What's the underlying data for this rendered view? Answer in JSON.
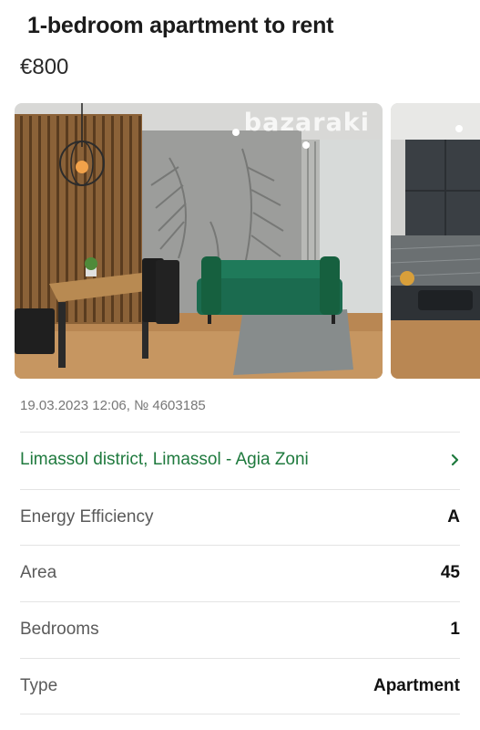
{
  "listing": {
    "title": "1-bedroom apartment to rent",
    "price": "€800",
    "meta": "19.03.2023 12:06, № 4603185",
    "location": "Limassol district, Limassol - Agia Zoni"
  },
  "gallery": {
    "watermark": "bazaraki",
    "images": [
      "living-room-photo",
      "kitchen-photo"
    ]
  },
  "details": [
    {
      "label": "Energy Efficiency",
      "value": "A"
    },
    {
      "label": "Area",
      "value": "45"
    },
    {
      "label": "Bedrooms",
      "value": "1"
    },
    {
      "label": "Type",
      "value": "Apartment"
    }
  ],
  "icons": {
    "location_link": "chevron-right-icon"
  },
  "colors": {
    "location_link": "#1f7a3e",
    "divider": "#e4e4e4"
  }
}
